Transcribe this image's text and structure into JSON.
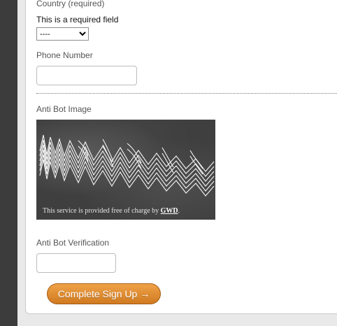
{
  "form": {
    "country": {
      "label": "Country (required)",
      "required_message": "This is a required field",
      "selected": "----"
    },
    "phone": {
      "label": "Phone Number",
      "value": ""
    },
    "captcha": {
      "label": "Anti Bot Image",
      "footer_text": "This service is provided free of charge by ",
      "footer_link": "GWD",
      "footer_end": "."
    },
    "verification": {
      "label": "Anti Bot Verification",
      "value": ""
    },
    "submit_label": "Complete Sign Up →"
  },
  "colors": {
    "button_orange": "#e08a2c",
    "sidebar_dark": "#3c3c3c"
  }
}
